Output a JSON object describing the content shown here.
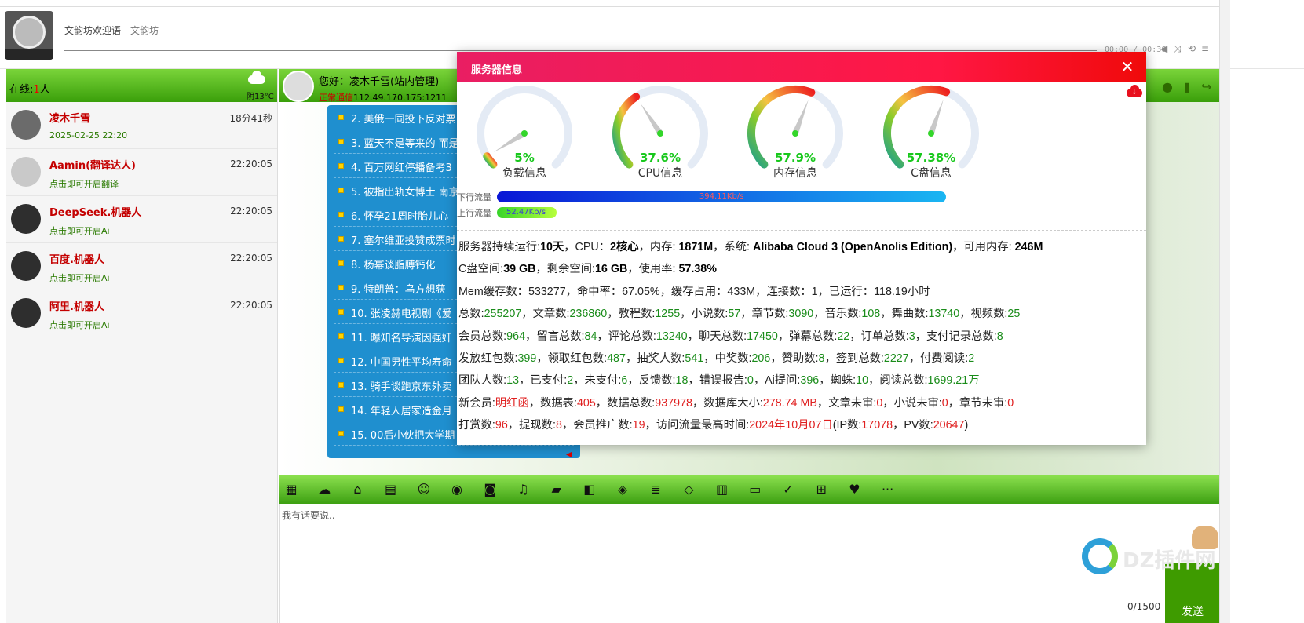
{
  "header": {
    "welcome_title": "文韵坊欢迎语",
    "welcome_sep": " - ",
    "welcome_site": "文韵坊",
    "player_time": "00:00 / 00:36"
  },
  "sidebar": {
    "online_label": "在线:",
    "online_count": "1",
    "online_unit": "人",
    "weather": "阴13°C",
    "users": [
      {
        "name": "凌木千雪",
        "desc": "2025-02-25 22:20",
        "time": "18分41秒",
        "avatar": "girl"
      },
      {
        "name": "Aamin(翻译达人)",
        "desc": "点击即可开启翻译",
        "time": "22:20:05",
        "avatar": "dog"
      },
      {
        "name": "DeepSeek.机器人",
        "desc": "点击即可开启Ai",
        "time": "22:20:05",
        "avatar": "bot"
      },
      {
        "name": "百度.机器人",
        "desc": "点击即可开启Ai",
        "time": "22:20:05",
        "avatar": "bot"
      },
      {
        "name": "阿里.机器人",
        "desc": "点击即可开启Ai",
        "time": "22:20:05",
        "avatar": "bot"
      }
    ]
  },
  "chat_header": {
    "hello": "您好：凌木千雪(站内管理)",
    "status": "正常通信",
    "ip": "112.49.170.175:1211"
  },
  "news": [
    "2. 美俄一同投下反对票",
    "3. 蓝天不是等来的 而是",
    "4. 百万网红停播备考3",
    "5. 被指出轨女博士 南京",
    "6. 怀孕21周时胎儿心",
    "7. 塞尔维亚投赞成票时",
    "8. 杨幂谈脂膊钙化",
    "9. 特朗普：乌方想获",
    "10. 张凌赫电视剧《爱",
    "11. 曝知名导演因强奸",
    "12. 中国男性平均寿命",
    "13. 骑手谈跑京东外卖",
    "14. 年轻人居家造金月",
    "15. 00后小伙把大学期"
  ],
  "input": {
    "placeholder": "我有话要说..",
    "counter": "0/1500",
    "send_label": "发送"
  },
  "watermark": "DZ插件网",
  "modal": {
    "title": "服务器信息",
    "gauges": [
      {
        "label": "负载信息",
        "value": 5,
        "display": "5%"
      },
      {
        "label": "CPU信息",
        "value": 37.6,
        "display": "37.6%"
      },
      {
        "label": "内存信息",
        "value": 57.9,
        "display": "57.9%"
      },
      {
        "label": "C盘信息",
        "value": 57.38,
        "display": "57.38%"
      }
    ],
    "down_label": "下行流量",
    "down_value": "394.11Kb/s",
    "down_fraction": 0.98,
    "up_label": "上行流量",
    "up_value": "52.47Kb/s",
    "up_fraction": 0.13
  },
  "stats": [
    [
      [
        "服务器持续运行:",
        ""
      ],
      [
        "10天",
        "b"
      ],
      [
        "，CPU：",
        ""
      ],
      [
        "2核心",
        "b"
      ],
      [
        "，内存: ",
        ""
      ],
      [
        "1871M",
        "b"
      ],
      [
        "，系统: ",
        ""
      ],
      [
        "Alibaba Cloud 3 (OpenAnolis Edition)",
        "b"
      ],
      [
        "，可用内存: ",
        ""
      ],
      [
        "246M",
        "b"
      ]
    ],
    [
      [
        "C盘空间:",
        ""
      ],
      [
        "39 GB",
        "b"
      ],
      [
        "，剩余空间:",
        ""
      ],
      [
        "16 GB",
        "b"
      ],
      [
        "，使用率: ",
        ""
      ],
      [
        "57.38%",
        "b"
      ]
    ],
    [
      [
        "Mem缓存数：533277，命中率：67.05%，缓存占用：433M，连接数：1，已运行：118.19小时",
        ""
      ]
    ],
    [
      [
        "总数:",
        ""
      ],
      [
        "255207",
        "g"
      ],
      [
        "，文章数:",
        ""
      ],
      [
        "236860",
        "g"
      ],
      [
        "，教程数:",
        ""
      ],
      [
        "1255",
        "g"
      ],
      [
        "，小说数:",
        ""
      ],
      [
        "57",
        "g"
      ],
      [
        "，章节数:",
        ""
      ],
      [
        "3090",
        "g"
      ],
      [
        "，音乐数:",
        ""
      ],
      [
        "108",
        "g"
      ],
      [
        "，舞曲数:",
        ""
      ],
      [
        "13740",
        "g"
      ],
      [
        "，视频数:",
        ""
      ],
      [
        "25",
        "g"
      ]
    ],
    [
      [
        "会员总数:",
        ""
      ],
      [
        "964",
        "g"
      ],
      [
        "，留言总数:",
        ""
      ],
      [
        "84",
        "g"
      ],
      [
        "，评论总数:",
        ""
      ],
      [
        "13240",
        "g"
      ],
      [
        "，聊天总数:",
        ""
      ],
      [
        "17450",
        "g"
      ],
      [
        "，弹幕总数:",
        ""
      ],
      [
        "22",
        "g"
      ],
      [
        "，订单总数:",
        ""
      ],
      [
        "3",
        "g"
      ],
      [
        "，支付记录总数:",
        ""
      ],
      [
        "8",
        "g"
      ]
    ],
    [
      [
        "发放红包数:",
        ""
      ],
      [
        "399",
        "g"
      ],
      [
        "，领取红包数:",
        ""
      ],
      [
        "487",
        "g"
      ],
      [
        "，抽奖人数:",
        ""
      ],
      [
        "541",
        "g"
      ],
      [
        "，中奖数:",
        ""
      ],
      [
        "206",
        "g"
      ],
      [
        "，赞助数:",
        ""
      ],
      [
        "8",
        "g"
      ],
      [
        "，签到总数:",
        ""
      ],
      [
        "2227",
        "g"
      ],
      [
        "，付费阅读:",
        ""
      ],
      [
        "2",
        "g"
      ]
    ],
    [
      [
        "团队人数:",
        ""
      ],
      [
        "13",
        "g"
      ],
      [
        "，已支付:",
        ""
      ],
      [
        "2",
        "g"
      ],
      [
        "，未支付:",
        ""
      ],
      [
        "6",
        "g"
      ],
      [
        "，反馈数:",
        ""
      ],
      [
        "18",
        "g"
      ],
      [
        "，错误报告:",
        ""
      ],
      [
        "0",
        "g"
      ],
      [
        "，Ai提问:",
        ""
      ],
      [
        "396",
        "g"
      ],
      [
        "，蜘蛛:",
        ""
      ],
      [
        "10",
        "g"
      ],
      [
        "，阅读总数:",
        ""
      ],
      [
        "1699.21万",
        "g"
      ]
    ],
    [
      [
        "新会员:",
        ""
      ],
      [
        "明红函",
        "r"
      ],
      [
        "，数据表:",
        ""
      ],
      [
        "405",
        "r"
      ],
      [
        "，数据总数:",
        ""
      ],
      [
        "937978",
        "r"
      ],
      [
        "，数据库大小:",
        ""
      ],
      [
        "278.74 MB",
        "r"
      ],
      [
        "，文章未审:",
        ""
      ],
      [
        "0",
        "r"
      ],
      [
        "，小说未审:",
        ""
      ],
      [
        "0",
        "r"
      ],
      [
        "，章节未审:",
        ""
      ],
      [
        "0",
        "r"
      ]
    ],
    [
      [
        "打赏数:",
        ""
      ],
      [
        "96",
        "r"
      ],
      [
        "，提现数:",
        ""
      ],
      [
        "8",
        "r"
      ],
      [
        "，会员推广数:",
        ""
      ],
      [
        "19",
        "r"
      ],
      [
        "，访问流量最高时间:",
        ""
      ],
      [
        "2024年10月07日",
        "r"
      ],
      [
        "(IP数:",
        ""
      ],
      [
        "17078",
        "r"
      ],
      [
        "，PV数:",
        ""
      ],
      [
        "20647",
        "r"
      ],
      [
        ")",
        ""
      ]
    ]
  ],
  "toolbar_icons": [
    "grid-icon",
    "cloud-icon",
    "bank-icon",
    "id-card-icon",
    "smile-icon",
    "user-circle-icon",
    "camera-icon",
    "music-icon",
    "folder-icon",
    "puzzle-icon",
    "rss-icon",
    "server-icon",
    "diamond-icon",
    "database-icon",
    "monitor-icon",
    "twitter-icon",
    "windows-icon",
    "heart-icon",
    "more-icon"
  ],
  "colors": {
    "accent_green": "#3a9f0a",
    "modal_red": "#ff1744",
    "gauge_value": "#18c81c"
  }
}
